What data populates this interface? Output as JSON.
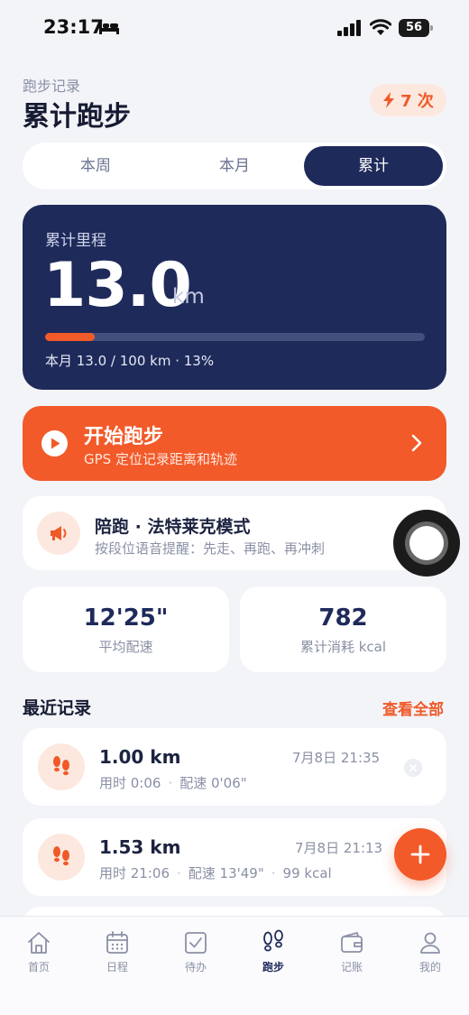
{
  "status": {
    "time": "23:17",
    "battery": "56"
  },
  "header": {
    "subtitle": "跑步记录",
    "title": "累计跑步",
    "streak": "7 次"
  },
  "tabs": [
    {
      "label": "本周",
      "active": false
    },
    {
      "label": "本月",
      "active": false
    },
    {
      "label": "累计",
      "active": true
    }
  ],
  "hero": {
    "label": "累计里程",
    "value": "13.0",
    "unit": "km",
    "progress": 0.13,
    "caption": "本月 13.0 / 100 km · 13%"
  },
  "start": {
    "title": "开始跑步",
    "subtitle": "GPS 定位记录距离和轨迹"
  },
  "pace_mode": {
    "title": "陪跑 · 法特莱克模式",
    "subtitle": "按段位语音提醒：先走、再跑、再冲刺"
  },
  "stats": [
    {
      "value": "12'25\"",
      "label": "平均配速"
    },
    {
      "value": "782",
      "label": "累计消耗 kcal"
    }
  ],
  "recent": {
    "title": "最近记录",
    "see_all": "查看全部",
    "records": [
      {
        "distance": "1.00 km",
        "date": "7月8日 21:35",
        "time": "用时 0:06",
        "pace": "配速 0'06\"",
        "kcal": ""
      },
      {
        "distance": "1.53 km",
        "date": "7月8日 21:13",
        "time": "用时 21:06",
        "pace": "配速 13'49\"",
        "kcal": "99 kcal"
      }
    ]
  },
  "tabbar": [
    {
      "label": "首页",
      "icon": "home-icon"
    },
    {
      "label": "日程",
      "icon": "calendar-icon"
    },
    {
      "label": "待办",
      "icon": "checkbox-icon"
    },
    {
      "label": "跑步",
      "icon": "footprints-icon",
      "active": true
    },
    {
      "label": "记账",
      "icon": "wallet-icon"
    },
    {
      "label": "我的",
      "icon": "person-icon"
    }
  ],
  "colors": {
    "accent": "#f25a29",
    "navy": "#1e2a5a",
    "background": "#f3f4f8"
  }
}
